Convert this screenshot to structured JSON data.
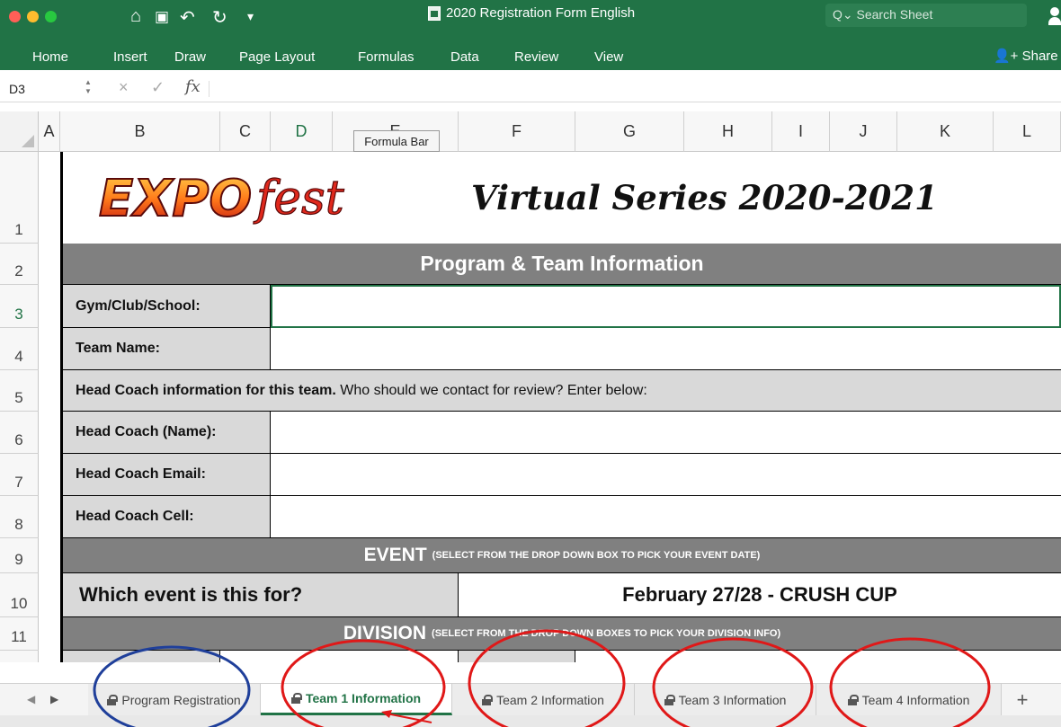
{
  "window": {
    "title": "2020 Registration Form English",
    "search_placeholder": "Search Sheet"
  },
  "ribbon": {
    "tabs": [
      "Home",
      "Insert",
      "Draw",
      "Page Layout",
      "Formulas",
      "Data",
      "Review",
      "View"
    ],
    "share_label": "Share"
  },
  "formula_bar": {
    "name_box": "D3",
    "fx": "fx",
    "tooltip": "Formula Bar"
  },
  "columns": [
    "A",
    "B",
    "C",
    "D",
    "E",
    "F",
    "G",
    "H",
    "I",
    "J",
    "K",
    "L"
  ],
  "selected_column": "D",
  "rows": [
    "1",
    "2",
    "3",
    "4",
    "5",
    "6",
    "7",
    "8",
    "9",
    "10",
    "11"
  ],
  "selected_row": "3",
  "sheet": {
    "logo_text": "EXPOfest",
    "series_title": "Virtual Series 2020-2021",
    "section_program": "Program & Team Information",
    "gym_label": "Gym/Club/School:",
    "team_label": "Team Name:",
    "coach_info_bold": "Head Coach information for this team.",
    "coach_info_rest": "Who should we contact for review? Enter below:",
    "coach_name_label": "Head Coach (Name):",
    "coach_email_label": "Head Coach Email:",
    "coach_cell_label": "Head Coach Cell:",
    "event_title": "EVENT",
    "event_hint": "(SELECT FROM THE DROP DOWN BOX TO PICK YOUR EVENT DATE)",
    "event_question": "Which event is this for?",
    "event_value": "February 27/28 - CRUSH CUP",
    "division_title": "DIVISION",
    "division_hint": "(SELECT FROM THE DROP DOWN BOXES TO PICK YOUR DIVISION INFO)"
  },
  "sheet_tabs": [
    {
      "label": "Program Registration"
    },
    {
      "label": "Team 1 Information"
    },
    {
      "label": "Team 2 Information"
    },
    {
      "label": "Team 3 Information"
    },
    {
      "label": "Team 4 Information"
    }
  ],
  "add_sheet_label": "+",
  "colors": {
    "ribbon": "#217346",
    "band": "#808080",
    "label_fill": "#d9d9d9",
    "logo_red": "#c62020",
    "circle_blue": "#1f3f9a",
    "circle_red": "#e01818"
  }
}
